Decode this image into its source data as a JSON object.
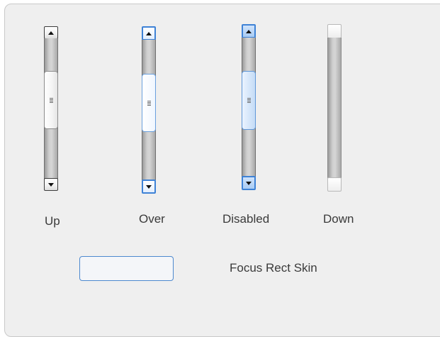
{
  "scrollbars": [
    {
      "state_label": "Up"
    },
    {
      "state_label": "Over"
    },
    {
      "state_label": "Disabled"
    },
    {
      "state_label": "Down"
    }
  ],
  "focus_rect": {
    "label": "Focus Rect Skin"
  },
  "icons": {
    "up_arrow": "triangle-up",
    "down_arrow": "triangle-down",
    "grip": "three-line-grip"
  },
  "colors": {
    "panel_bg": "#efefef",
    "focus_blue": "#3e82d6",
    "text": "#3a3a3a"
  }
}
